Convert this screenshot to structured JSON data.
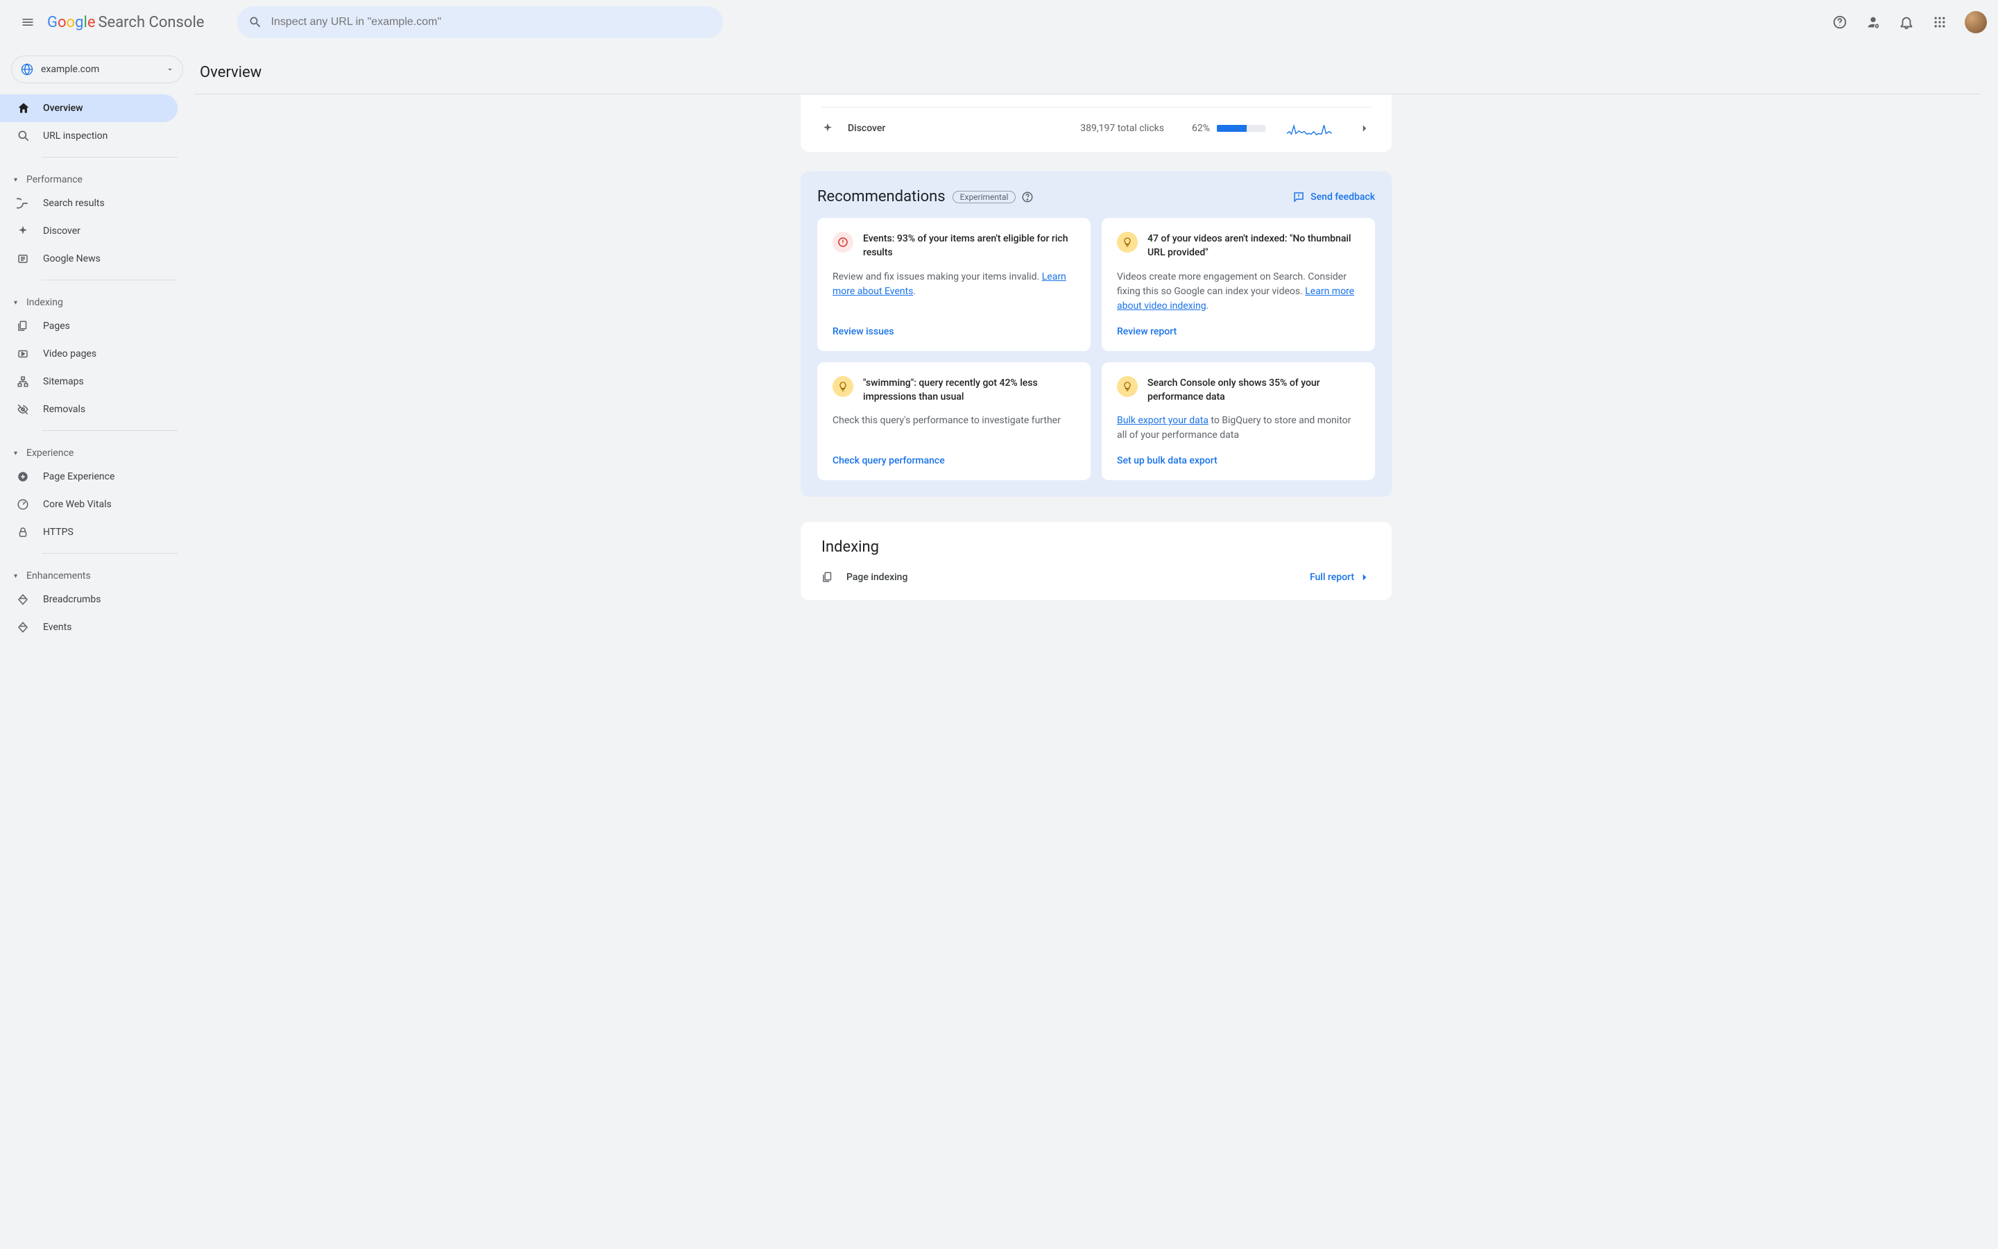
{
  "brand": {
    "google": "Google",
    "product": "Search Console"
  },
  "search": {
    "placeholder": "Inspect any URL in \"example.com\""
  },
  "property": {
    "name": "example.com"
  },
  "sidebar": {
    "overview": "Overview",
    "url_inspection": "URL inspection",
    "sections": {
      "performance": "Performance",
      "indexing": "Indexing",
      "experience": "Experience",
      "enhancements": "Enhancements"
    },
    "performance_items": [
      "Search results",
      "Discover",
      "Google News"
    ],
    "indexing_items": [
      "Pages",
      "Video pages",
      "Sitemaps",
      "Removals"
    ],
    "experience_items": [
      "Page Experience",
      "Core Web Vitals",
      "HTTPS"
    ],
    "enhancements_items": [
      "Breadcrumbs",
      "Events"
    ]
  },
  "page": {
    "title": "Overview"
  },
  "discover": {
    "label": "Discover",
    "clicks_text": "389,197 total clicks",
    "percent_text": "62%",
    "percent_value": 62
  },
  "recommendations": {
    "title": "Recommendations",
    "badge": "Experimental",
    "feedback": "Send feedback",
    "cards": [
      {
        "icon": "error",
        "title": "Events: 93% of your items aren't eligible for rich results",
        "body_pre": "Review and fix issues making your items invalid. ",
        "link": "Learn more about Events",
        "body_post": ".",
        "action": "Review issues"
      },
      {
        "icon": "bulb",
        "title": "47 of your videos aren't indexed: \"No thumbnail URL provided\"",
        "body_pre": "Videos create more engagement on Search. Consider fixing this so Google can index your videos. ",
        "link": "Learn more about video indexing",
        "body_post": ".",
        "action": "Review report"
      },
      {
        "icon": "bulb",
        "title": "\"swimming\": query recently got 42% less impressions than usual",
        "body_pre": "Check this query's performance to investigate further",
        "link": "",
        "body_post": "",
        "action": "Check query performance"
      },
      {
        "icon": "bulb",
        "title": "Search Console only shows 35% of your performance data",
        "body_pre": "",
        "link": "Bulk export your data",
        "body_post": " to BigQuery to store and monitor all of your performance data",
        "action": "Set up bulk data export"
      }
    ]
  },
  "indexing": {
    "title": "Indexing",
    "row": "Page indexing",
    "full_report": "Full report"
  },
  "colors": {
    "blue": "#1a73e8",
    "grey": "#5f6368"
  }
}
